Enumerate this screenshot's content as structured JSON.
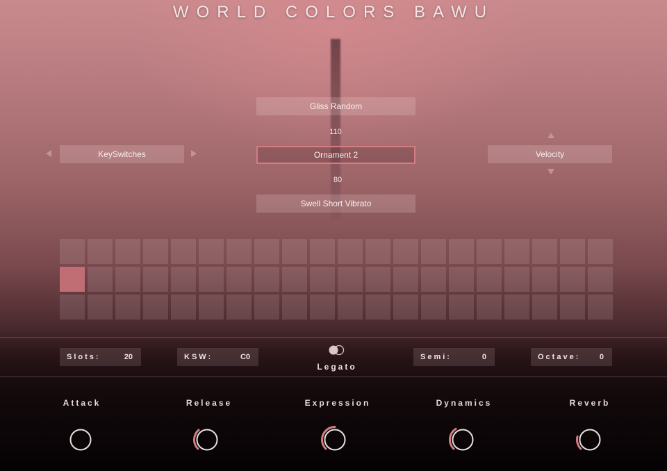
{
  "title": "WORLD COLORS BAWU",
  "articulations": {
    "top": "Gliss Random",
    "top_value": "110",
    "selected": "Ornament 2",
    "bottom_value": "80",
    "bottom": "Swell Short Vibrato"
  },
  "keyswitches": {
    "label": "KeySwitches"
  },
  "velocity": {
    "label": "Velocity"
  },
  "slot_grid": {
    "columns": 20,
    "rows": 3,
    "active_slot": {
      "row": 2,
      "column": 1
    }
  },
  "fields": {
    "slots": {
      "label": "Slots:",
      "value": "20"
    },
    "ksw": {
      "label": "KSW:",
      "value": "C0"
    },
    "legato": {
      "label": "Legato",
      "enabled": true
    },
    "semi": {
      "label": "Semi:",
      "value": "0"
    },
    "octave": {
      "label": "Octave:",
      "value": "0"
    }
  },
  "knobs": [
    {
      "label": "Attack",
      "level": 0.0
    },
    {
      "label": "Release",
      "level": 0.35
    },
    {
      "label": "Expression",
      "level": 0.5
    },
    {
      "label": "Dynamics",
      "level": 0.38
    },
    {
      "label": "Reverb",
      "level": 0.22
    }
  ],
  "colors": {
    "accent": "#d67d82",
    "knob_ring": "#e6e1e1",
    "active_slot": "#c06e73"
  }
}
